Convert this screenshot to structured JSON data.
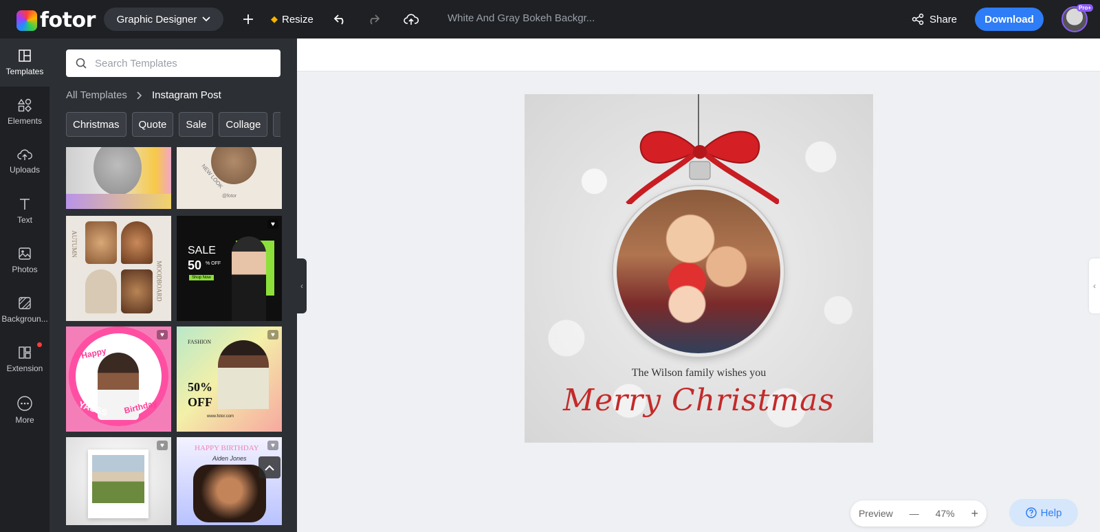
{
  "app": {
    "logo_text": "fotor",
    "role_label": "Graphic Designer",
    "resize_label": "Resize",
    "doc_title": "White And Gray Bokeh Backgr...",
    "share_label": "Share",
    "download_label": "Download",
    "pro_badge": "Pro+"
  },
  "rail": {
    "items": [
      {
        "label": "Templates",
        "icon": "templates-icon"
      },
      {
        "label": "Elements",
        "icon": "elements-icon"
      },
      {
        "label": "Uploads",
        "icon": "upload-icon"
      },
      {
        "label": "Text",
        "icon": "text-icon"
      },
      {
        "label": "Photos",
        "icon": "photos-icon"
      },
      {
        "label": "Backgroun...",
        "icon": "background-icon"
      },
      {
        "label": "Extension",
        "icon": "extension-icon"
      },
      {
        "label": "More",
        "icon": "more-icon"
      }
    ]
  },
  "panel": {
    "search_placeholder": "Search Templates",
    "breadcrumb": {
      "root": "All Templates",
      "current": "Instagram Post"
    },
    "chips": [
      "Christmas",
      "Quote",
      "Sale",
      "Collage",
      "S>"
    ],
    "templates": {
      "t2_text": "NEW LOOK",
      "t2_sub": "@fotor",
      "t3_left": "AUTUMN",
      "t3_right": "MOODBOARD",
      "t4_sale": "SALE",
      "t4_pct": "50",
      "t4_off": "% OFF",
      "t4_btn": "Shop Now",
      "t5_happy": "Happy",
      "t5_birthday": "Birthday",
      "t5_yasss": "YASSS",
      "t6_fashion": "FASHION",
      "t6_pct": "50%",
      "t6_off": "OFF",
      "t6_url": "www.fotor.com",
      "t8_title": "HAPPY BIRTHDAY",
      "t8_name": "Aiden Jones"
    }
  },
  "design": {
    "caption": "The Wilson family wishes you",
    "headline": "Merry Christmas"
  },
  "zoom": {
    "preview_label": "Preview",
    "level": "47%"
  },
  "help_label": "Help",
  "colors": {
    "topbar": "#1e2024",
    "accent": "#2e7cf6",
    "panel": "#2c2f34",
    "headline": "#c42a2a"
  }
}
